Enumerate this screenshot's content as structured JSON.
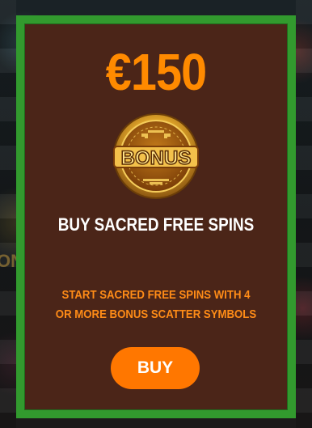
{
  "offer": {
    "price": "€150",
    "badge_text": "BONUS",
    "title": "BUY SACRED FREE SPINS",
    "description": "START SACRED FREE SPINS WITH 4 OR MORE BONUS SCATTER SYMBOLS",
    "buy_label": "BUY"
  },
  "background": {
    "partial_symbol_text": "ONUS"
  },
  "colors": {
    "border": "#329a2e",
    "card": "#4b2518",
    "price": "#ff8a00",
    "button": "#ff7700",
    "description": "#ff8c17",
    "title": "#ffffff",
    "badge_gold": "#e0a52a"
  },
  "icons": {
    "badge": "bonus-coin-icon"
  }
}
